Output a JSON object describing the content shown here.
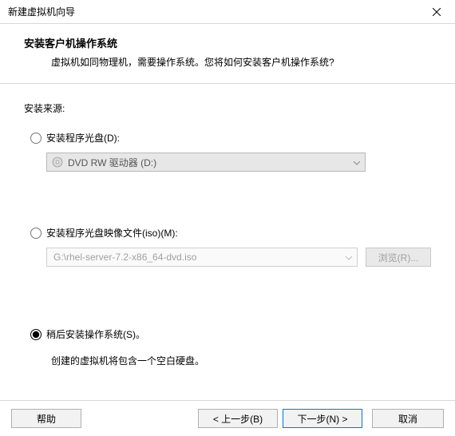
{
  "titlebar": {
    "title": "新建虚拟机向导"
  },
  "header": {
    "heading": "安装客户机操作系统",
    "sub": "虚拟机如同物理机，需要操作系统。您将如何安装客户机操作系统?"
  },
  "source_label": "安装来源:",
  "opt_disc": {
    "label": "安装程序光盘(D):",
    "drive": "DVD RW 驱动器 (D:)"
  },
  "opt_iso": {
    "label": "安装程序光盘映像文件(iso)(M):",
    "path": "G:\\rhel-server-7.2-x86_64-dvd.iso",
    "browse": "浏览(R)..."
  },
  "opt_later": {
    "label": "稍后安装操作系统(S)。",
    "note": "创建的虚拟机将包含一个空白硬盘。"
  },
  "footer": {
    "help": "帮助",
    "back": "< 上一步(B)",
    "next": "下一步(N) >",
    "cancel": "取消"
  }
}
